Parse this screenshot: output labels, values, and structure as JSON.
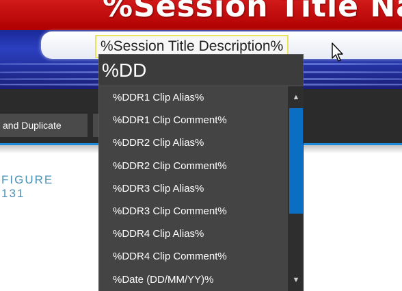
{
  "banner": {
    "session_name": "%Session Title Nam",
    "session_description": "%Session Title Description%"
  },
  "toolbar": {
    "duplicate_label": "and Duplicate"
  },
  "caption": {
    "line1": "FIGURE",
    "line2": "131"
  },
  "autocomplete": {
    "query": "%DD",
    "items": [
      "%DDR1 Clip Alias%",
      "%DDR1 Clip Comment%",
      "%DDR2 Clip Alias%",
      "%DDR2 Clip Comment%",
      "%DDR3 Clip Alias%",
      "%DDR3 Clip Comment%",
      "%DDR4 Clip Alias%",
      "%DDR4 Clip Comment%",
      "%Date (DD/MM/YY)%"
    ],
    "scroll_up_icon": "triangle-up",
    "scroll_down_icon": "triangle-down"
  },
  "colors": {
    "accent_blue": "#1e88d8",
    "scroll_thumb": "#0a6fc2",
    "caption": "#4a8fb3",
    "banner_red": "#c00000",
    "highlight_border": "#e8e35a"
  }
}
